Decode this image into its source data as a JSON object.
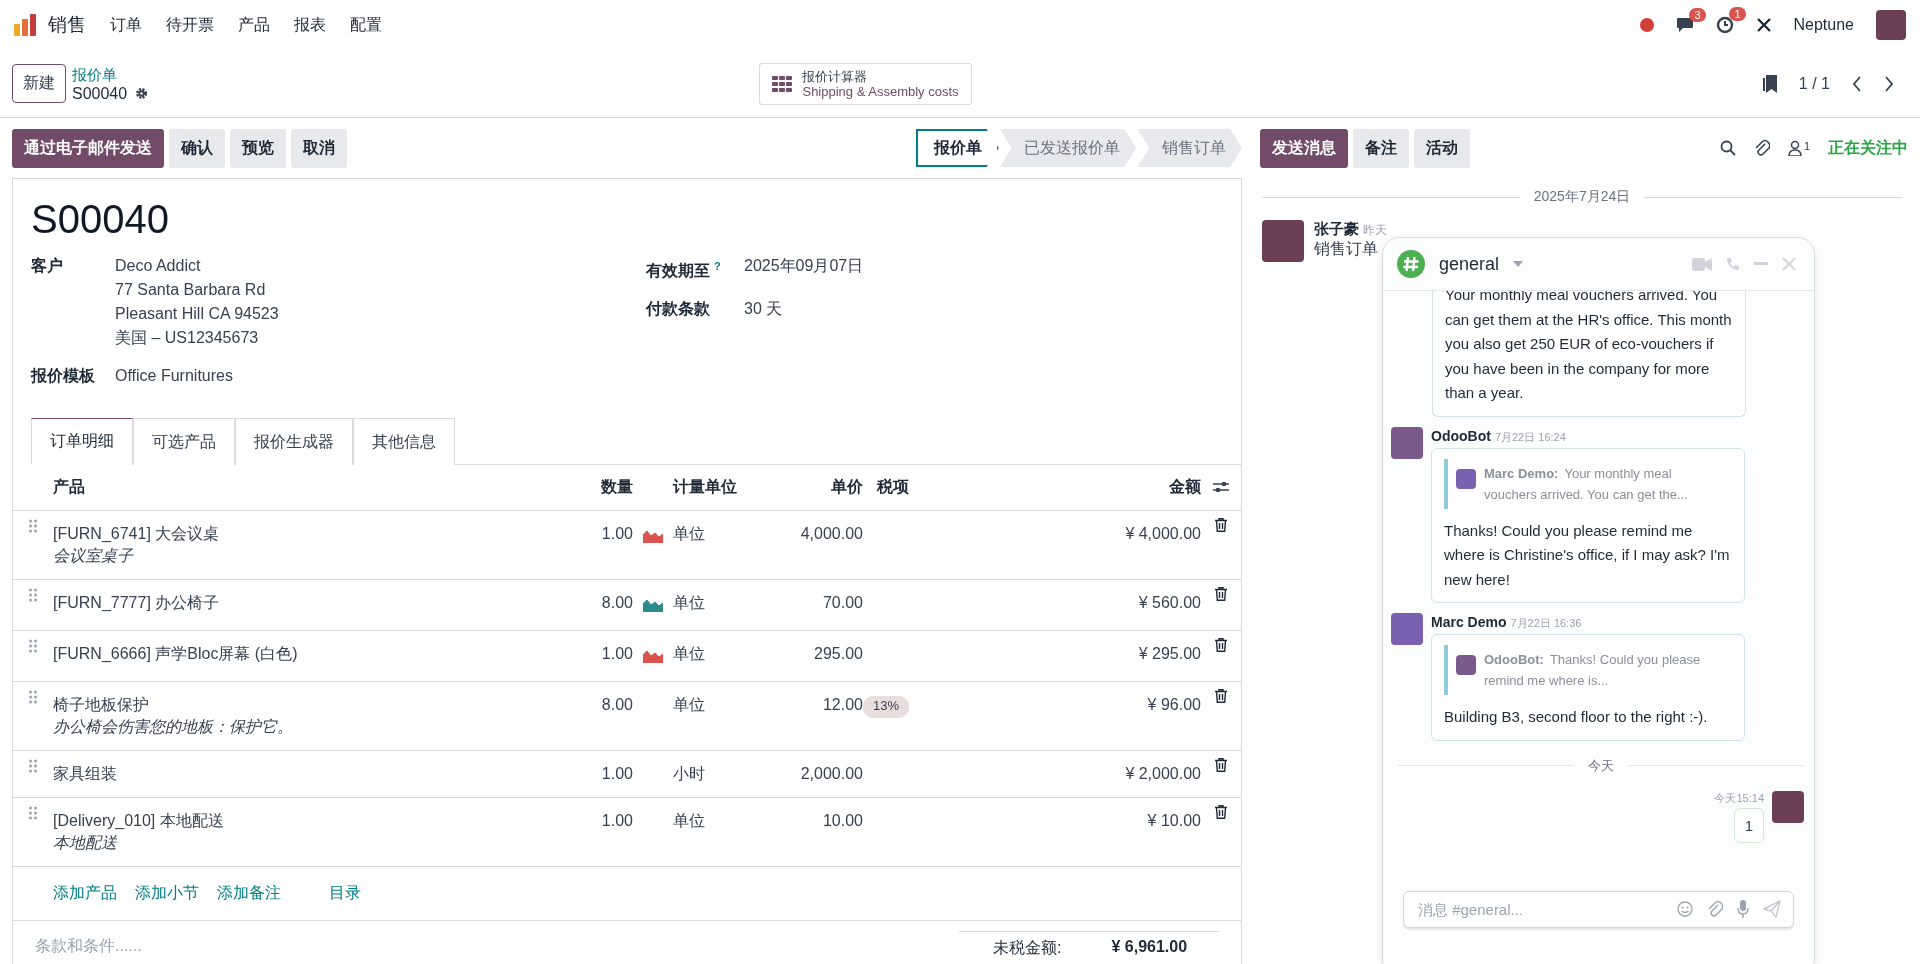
{
  "navbar": {
    "app": "销售",
    "menu": [
      "订单",
      "待开票",
      "产品",
      "报表",
      "配置"
    ],
    "message_count": "3",
    "activity_count": "1",
    "user": "Neptune"
  },
  "control_panel": {
    "new_button": "新建",
    "breadcrumb": "报价单",
    "record": "S00040",
    "calculator": {
      "title": "报价计算器",
      "subtitle": "Shipping & Assembly costs"
    },
    "pager": "1 / 1"
  },
  "actions": [
    {
      "label": "通过电子邮件发送",
      "primary": true
    },
    {
      "label": "确认",
      "primary": false
    },
    {
      "label": "预览",
      "primary": false
    },
    {
      "label": "取消",
      "primary": false
    }
  ],
  "statusbar": [
    {
      "label": "报价单",
      "selected": true
    },
    {
      "label": "已发送报价单",
      "selected": false
    },
    {
      "label": "销售订单",
      "selected": false
    }
  ],
  "chatter_buttons": [
    {
      "label": "发送消息",
      "primary": true
    },
    {
      "label": "备注",
      "primary": false
    },
    {
      "label": "活动",
      "primary": false
    }
  ],
  "follower_count": "1",
  "follow_status": "正在关注中",
  "form": {
    "title": "S00040",
    "customer": {
      "label": "客户",
      "lines": [
        "Deco Addict",
        "77 Santa Barbara Rd",
        "Pleasant Hill CA 94523",
        "美国 – US12345673"
      ]
    },
    "validity": {
      "label": "有效期至",
      "help": "?",
      "value": "2025年09月07日"
    },
    "payment_terms": {
      "label": "付款条款",
      "value": "30 天"
    },
    "template": {
      "label": "报价模板",
      "value": "Office Furnitures"
    },
    "tabs": [
      {
        "label": "订单明细",
        "selected": true
      },
      {
        "label": "可选产品",
        "selected": false
      },
      {
        "label": "报价生成器",
        "selected": false
      },
      {
        "label": "其他信息",
        "selected": false
      }
    ],
    "columns": {
      "product": "产品",
      "quantity": "数量",
      "uom": "计量单位",
      "price": "单价",
      "taxes": "税项",
      "amount": "金额"
    },
    "rows": [
      {
        "product": "[FURN_6741] 大会议桌",
        "description": "会议室桌子",
        "quantity": "1.00",
        "color": "#d9534f",
        "uom": "单位",
        "price": "4,000.00",
        "amount": "¥ 4,000.00"
      },
      {
        "product": "[FURN_7777] 办公椅子",
        "quantity": "8.00",
        "color": "#2e8b8b",
        "uom": "单位",
        "price": "70.00",
        "amount": "¥ 560.00"
      },
      {
        "product": "[FURN_6666] 声学Bloc屏幕 (白色)",
        "quantity": "1.00",
        "color": "#d9534f",
        "uom": "单位",
        "price": "295.00",
        "amount": "¥ 295.00"
      },
      {
        "product": "椅子地板保护",
        "description": "办公椅会伤害您的地板：保护它。",
        "quantity": "8.00",
        "uom": "单位",
        "price": "12.00",
        "tax": "13%",
        "amount": "¥ 96.00"
      },
      {
        "product": "家具组装",
        "quantity": "1.00",
        "uom": "小时",
        "price": "2,000.00",
        "amount": "¥ 2,000.00"
      },
      {
        "product": "[Delivery_010] 本地配送",
        "description": "本地配送",
        "quantity": "1.00",
        "uom": "单位",
        "price": "10.00",
        "amount": "¥ 10.00"
      }
    ],
    "add_links": [
      "添加产品",
      "添加小节",
      "添加备注",
      "目录"
    ],
    "terms_placeholder": "条款和条件......",
    "untaxed": {
      "label": "未税金额:",
      "value": "¥ 6,961.00"
    }
  },
  "chatter": {
    "date": "2025年7月24日",
    "message": {
      "author": "张子豪",
      "time": "昨天",
      "body": "销售订单"
    }
  },
  "chat_window": {
    "channel": "general",
    "messages": [
      {
        "body": "Your monthly meal vouchers arrived. You can get them at the HR's office. This month you also get 250 EUR of eco-vouchers if you have been in the company for more than a year."
      },
      {
        "author": "OdooBot",
        "kind": "bot",
        "time": "7月22日 16:24",
        "quote": {
          "author": "Marc Demo:",
          "kind": "person",
          "text": "Your monthly meal vouchers arrived. You can get the..."
        },
        "body": "Thanks! Could you please remind me where is Christine's office, if I may ask? I'm new here!"
      },
      {
        "author": "Marc Demo",
        "kind": "person",
        "time": "7月22日 16:36",
        "quote": {
          "author": "OdooBot:",
          "kind": "bot",
          "text": "Thanks! Could you please remind me where is..."
        },
        "body": "Building B3, second floor to the right :-)."
      }
    ],
    "day": "今天",
    "own": {
      "time": "今天15:14",
      "body": "1"
    },
    "composer_placeholder": "消息 #general..."
  }
}
